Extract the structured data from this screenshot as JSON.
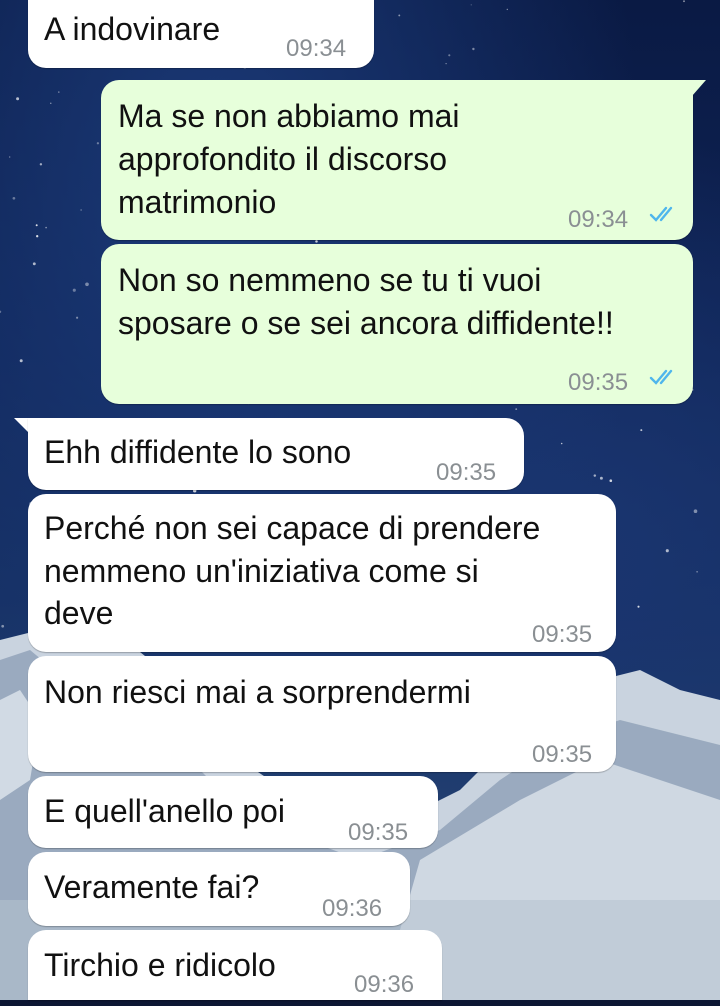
{
  "colors": {
    "incoming_bubble": "#ffffff",
    "outgoing_bubble": "#e7ffdb",
    "timestamp": "#8a8f93",
    "read_ticks": "#4fb6ec"
  },
  "messages": [
    {
      "direction": "incoming",
      "lines": [
        "A indovinare"
      ],
      "time": "09:34"
    },
    {
      "direction": "outgoing",
      "lines": [
        "Ma se non abbiamo mai",
        "approfondito il discorso",
        "matrimonio"
      ],
      "time": "09:34",
      "status_icon": "double-check-read-icon"
    },
    {
      "direction": "outgoing",
      "lines": [
        "Non so nemmeno se tu ti vuoi",
        "sposare o se sei ancora diffidente!!"
      ],
      "time": "09:35",
      "status_icon": "double-check-read-icon"
    },
    {
      "direction": "incoming",
      "lines": [
        "Ehh diffidente lo sono"
      ],
      "time": "09:35"
    },
    {
      "direction": "incoming",
      "lines": [
        "Perché non sei capace di prendere",
        "nemmeno un'iniziativa come si",
        "deve"
      ],
      "time": "09:35"
    },
    {
      "direction": "incoming",
      "lines": [
        "Non riesci mai a sorprendermi"
      ],
      "time": "09:35"
    },
    {
      "direction": "incoming",
      "lines": [
        "E quell'anello poi"
      ],
      "time": "09:35"
    },
    {
      "direction": "incoming",
      "lines": [
        "Veramente fai?"
      ],
      "time": "09:36"
    },
    {
      "direction": "incoming",
      "lines": [
        "Tirchio e ridicolo"
      ],
      "time": "09:36"
    }
  ]
}
